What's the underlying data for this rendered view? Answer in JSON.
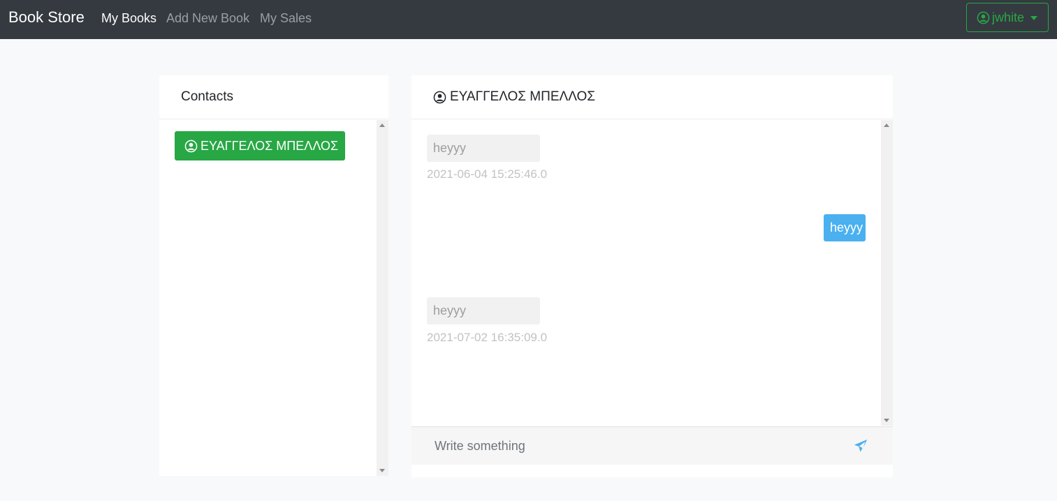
{
  "navbar": {
    "brand": "Book Store",
    "links": [
      "My Books",
      "Add New Book",
      "My Sales"
    ],
    "active_link": "My Books",
    "user": "jwhite"
  },
  "contacts": {
    "title": "Contacts",
    "items": [
      {
        "name": "ΕΥΑΓΓΕΛΟΣ ΜΠΕΛΛΟΣ"
      }
    ]
  },
  "chat": {
    "contact_name": "ΕΥΑΓΓΕΛΟΣ ΜΠΕΛΛΟΣ",
    "messages": [
      {
        "direction": "incoming",
        "text": "heyyy",
        "timestamp": "2021-06-04 15:25:46.0"
      },
      {
        "direction": "outgoing",
        "text": "heyyy"
      },
      {
        "direction": "incoming",
        "text": "heyyy",
        "timestamp": "2021-07-02 16:35:09.0"
      }
    ],
    "input_placeholder": "Write something",
    "input_value": ""
  },
  "colors": {
    "navbar_bg": "#343a40",
    "success": "#28a745",
    "outgoing_bubble": "#4ab0ef",
    "incoming_bubble": "#f1f1f1",
    "send_icon": "#4ab0ef"
  },
  "icons": [
    "user-circle-icon",
    "caret-down-icon",
    "paper-plane-icon",
    "scroll-up-arrow-icon",
    "scroll-down-arrow-icon"
  ]
}
